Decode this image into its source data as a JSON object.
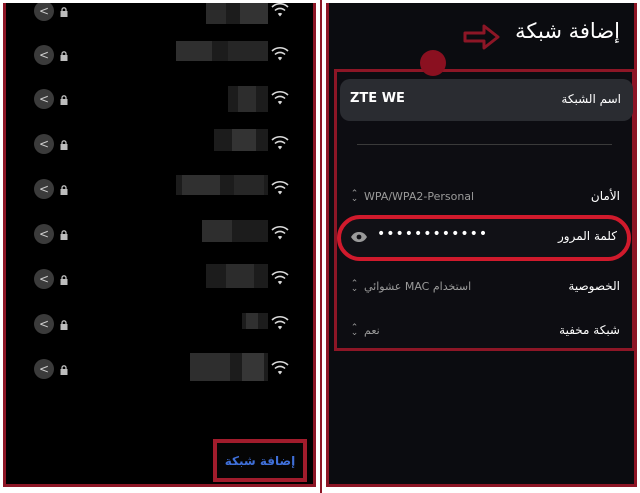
{
  "left_panel": {
    "rows": [
      {
        "chevron": "<"
      },
      {
        "chevron": "<"
      },
      {
        "chevron": "<"
      },
      {
        "chevron": "<"
      },
      {
        "chevron": "<"
      },
      {
        "chevron": "<"
      },
      {
        "chevron": "<"
      },
      {
        "chevron": "<"
      },
      {
        "chevron": "<"
      }
    ],
    "add_network_label": "إضافة شبكة"
  },
  "right_panel": {
    "title": "إضافة شبكة",
    "network_name_label": "اسم الشبكة",
    "network_name_value": "ZTE WE",
    "security_label": "الأمان",
    "security_value": "WPA/WPA2-Personal",
    "password_label": "كلمة المرور",
    "password_value": "••••••••••••",
    "privacy_label": "الخصوصية",
    "privacy_value": "استخدام MAC عشوائي",
    "hidden_label": "شبكة مخفية",
    "hidden_value": "نعم"
  },
  "colors": {
    "annotation_red": "#8d1626",
    "highlight_red": "#d01a2c",
    "link_blue": "#3f6fd8"
  },
  "icons": [
    "chevron-left-icon",
    "lock-icon",
    "wifi-icon",
    "arrow-right-icon",
    "eye-icon",
    "updown-icon"
  ]
}
